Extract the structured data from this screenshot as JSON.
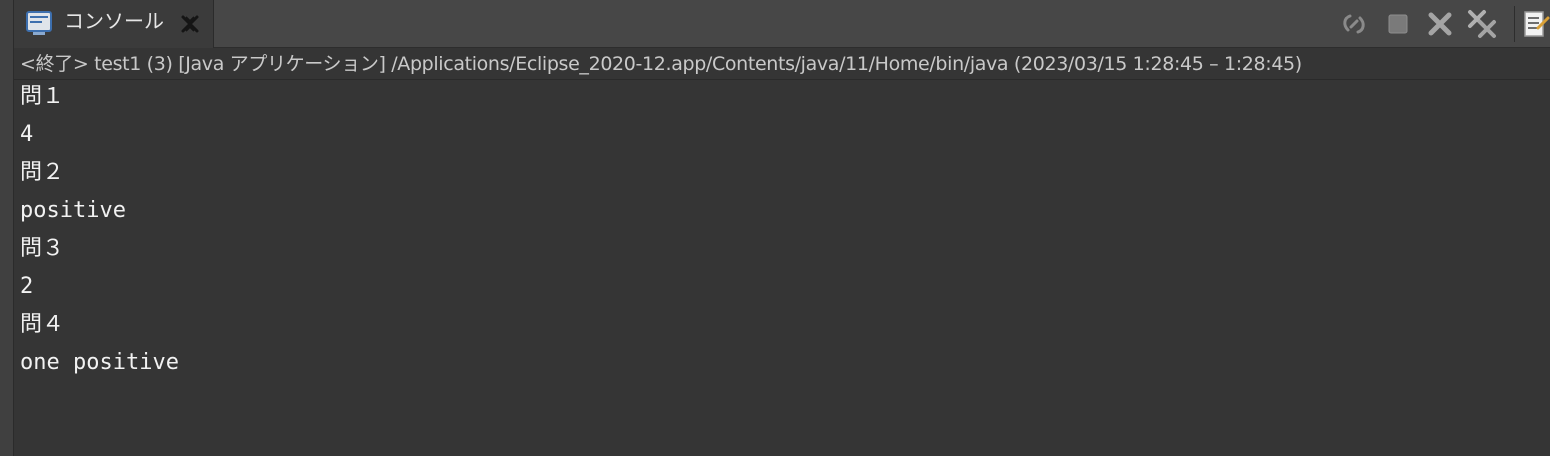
{
  "tab": {
    "icon": "console-icon",
    "label": "コンソール",
    "close_icon": "close-tab-icon"
  },
  "toolbar": {
    "icons": [
      "link-icon",
      "stop-icon",
      "remove-icon",
      "remove-all-icon",
      "document-icon"
    ]
  },
  "header": {
    "text": "<終了> test1 (3) [Java アプリケーション] /Applications/Eclipse_2020-12.app/Contents/java/11/Home/bin/java  (2023/03/15 1:28:45 – 1:28:45)"
  },
  "console": {
    "lines": [
      "問１",
      "4",
      "問２",
      "positive",
      "問３",
      "2",
      "問４",
      "one positive"
    ]
  },
  "colors": {
    "background": "#353535",
    "tab_bar": "#474747",
    "text": "#f2f2f2",
    "header_text": "#c9c9c9"
  }
}
